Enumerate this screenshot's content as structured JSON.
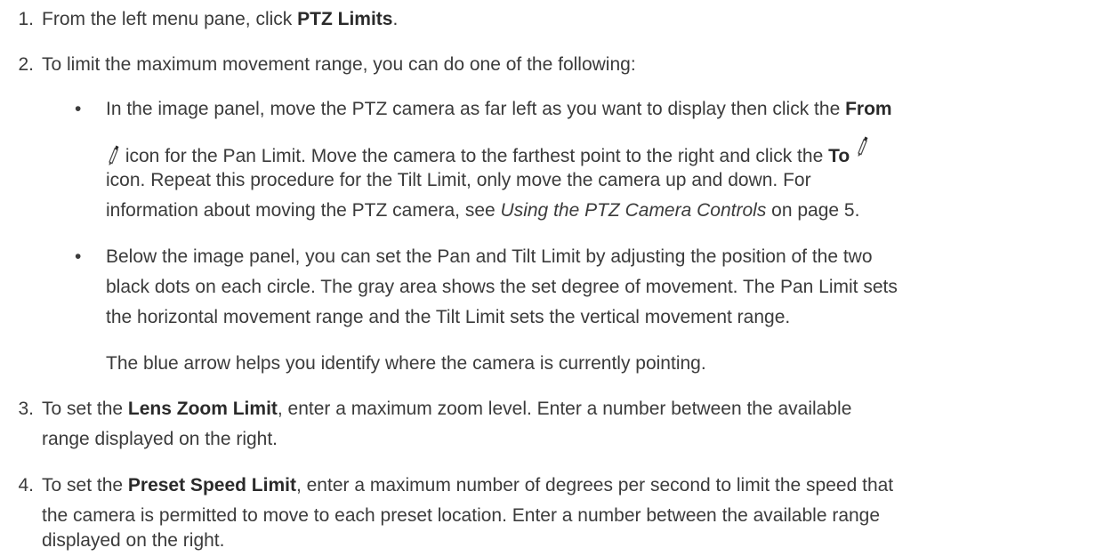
{
  "steps": [
    {
      "num": "1.",
      "pre": "From the left menu pane, click ",
      "bold": "PTZ Limits",
      "post": "."
    },
    {
      "num": "2.",
      "text": "To limit the maximum movement range, you can do one of the following:"
    },
    {
      "num": "3.",
      "pre": "To set the ",
      "bold": "Lens Zoom Limit",
      "post": ", enter a maximum zoom level. Enter a number between the available",
      "line2": "range displayed on the right."
    },
    {
      "num": "4.",
      "pre": "To set the ",
      "bold": "Preset Speed Limit",
      "post": ", enter a maximum number of degrees per second to limit the speed that",
      "line2": "the camera is permitted to move to each preset location. Enter a number between the available range",
      "line3": "displayed on the right."
    }
  ],
  "bullets": {
    "b1": {
      "l1_pre": "In the image panel, move the PTZ camera as far left as you want to display then click the ",
      "l1_bold": "From",
      "l2_pre": " icon for the Pan Limit. Move the camera to the farthest point to the right and click the ",
      "l2_bold": "To",
      "l3": "icon. Repeat this procedure for the Tilt Limit, only move the camera up and down. For",
      "l4_pre": "information about moving the PTZ camera, see ",
      "l4_link": "Using the PTZ Camera Controls",
      "l4_post": " on page 5."
    },
    "b2": {
      "l1": "Below the image panel, you can set the Pan and Tilt Limit by adjusting the position of the two",
      "l2": "black dots on each circle. The gray area shows the set degree of movement. The Pan Limit sets",
      "l3": "the horizontal movement range and the Tilt Limit sets the vertical movement range."
    },
    "note": "The blue arrow helps you identify where the camera is currently pointing."
  },
  "bullet_glyph": "•",
  "icons": {
    "from": "pencil-icon",
    "to": "pencil-icon"
  }
}
